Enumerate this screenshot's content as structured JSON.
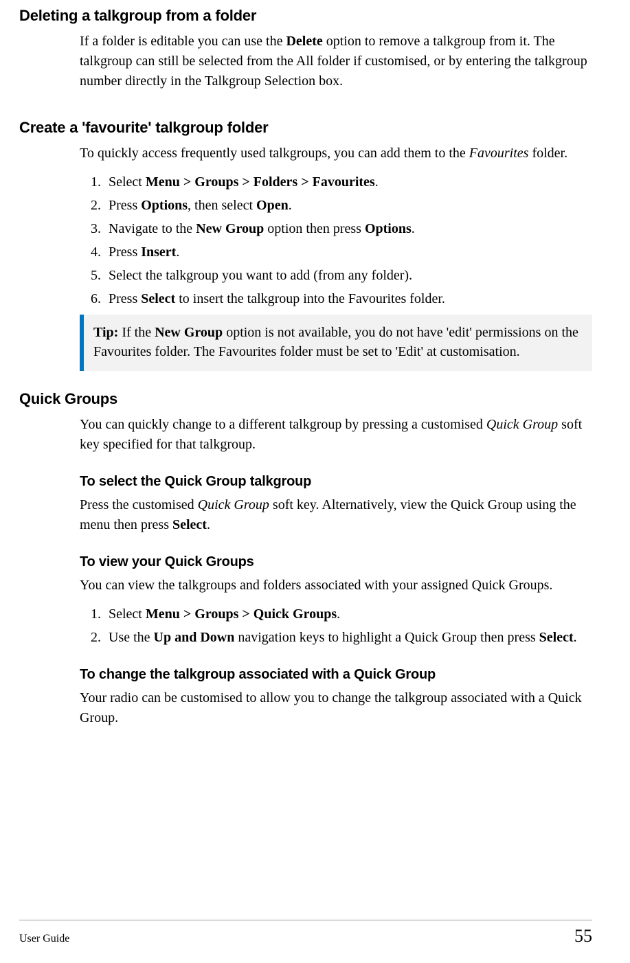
{
  "sections": {
    "delete": {
      "heading": "Deleting a talkgroup from a folder",
      "para_parts": {
        "p1": "If a folder is editable you can use the ",
        "b1": "Delete",
        "p2": " option to remove a talkgroup from it.  The talkgroup can still be selected from the All folder if customised, or by entering the talkgroup number directly in the Talkgroup Selection box."
      }
    },
    "favourite": {
      "heading": "Create a 'favourite' talkgroup folder",
      "para_parts": {
        "p1": "To quickly access frequently used talkgroups, you can add them to the ",
        "i1": "Favourites",
        "p2": " folder."
      },
      "steps": {
        "s1": {
          "t1": "Select ",
          "b1": "Menu > Groups > Folders > Favourites",
          "t2": "."
        },
        "s2": {
          "t1": "Press ",
          "b1": "Options",
          "t2": ", then select ",
          "b2": "Open",
          "t3": "."
        },
        "s3": {
          "t1": "Navigate to the ",
          "b1": "New Group",
          "t2": " option then press ",
          "b2": "Options",
          "t3": "."
        },
        "s4": {
          "t1": "Press ",
          "b1": "Insert",
          "t2": "."
        },
        "s5": {
          "t1": "Select the talkgroup you want to add (from any folder)."
        },
        "s6": {
          "t1": "Press ",
          "b1": "Select",
          "t2": " to insert the talkgroup into the Favourites folder."
        }
      },
      "tip": {
        "label": "Tip:  ",
        "t1": "If the ",
        "b1": "New Group",
        "t2": " option is not available, you do not have 'edit' permissions on the Favourites folder. The Favourites folder must be set to 'Edit' at customisation."
      }
    },
    "quick": {
      "heading": "Quick Groups",
      "para_parts": {
        "p1": "You can quickly change to a different talkgroup by pressing a customised ",
        "i1": "Quick Group",
        "p2": " soft key specified for that talkgroup."
      },
      "sub_select": {
        "heading": "To select the Quick Group talkgroup",
        "p1": "Press the customised ",
        "i1": "Quick Group",
        "p2": " soft key. Alternatively, view the Quick Group using the menu then press ",
        "b1": "Select",
        "p3": "."
      },
      "sub_view": {
        "heading": "To view your Quick Groups",
        "p1": "You can view the talkgroups and folders associated with your assigned Quick Groups.",
        "steps": {
          "s1": {
            "t1": "Select ",
            "b1": "Menu > Groups > Quick Groups",
            "t2": "."
          },
          "s2": {
            "t1": "Use the ",
            "b1": "Up and Down",
            "t2": " navigation keys to highlight a Quick Group then press ",
            "b2": "Select",
            "t3": "."
          }
        }
      },
      "sub_change": {
        "heading": "To change the talkgroup associated with a Quick Group",
        "p1": "Your radio can be customised to allow you to change the talkgroup associated with a Quick Group."
      }
    }
  },
  "footer": {
    "left": "User Guide",
    "right": "55"
  }
}
